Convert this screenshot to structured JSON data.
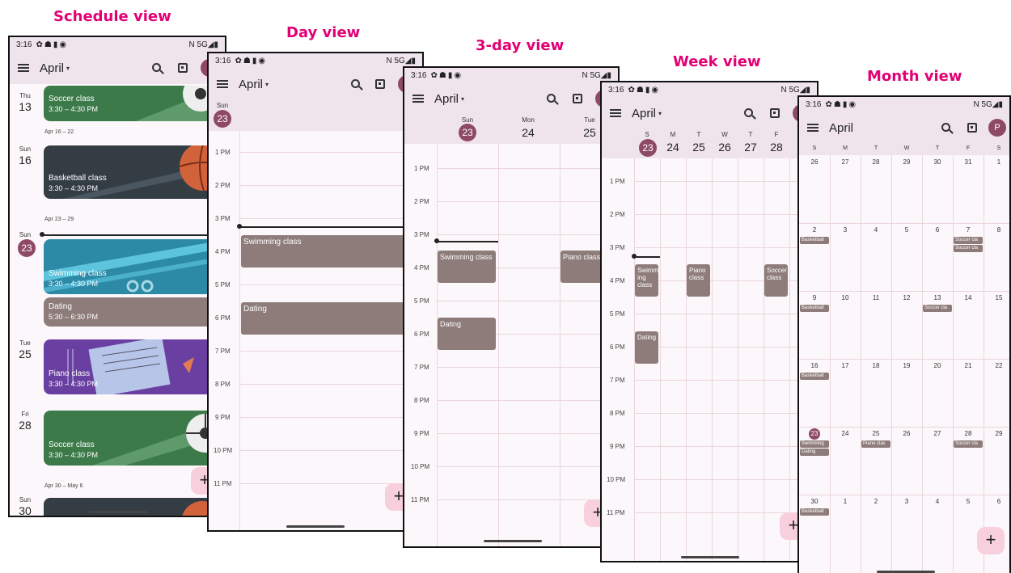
{
  "view_titles": {
    "schedule": "Schedule view",
    "day": "Day view",
    "three_day": "3-day view",
    "week": "Week view",
    "month": "Month view"
  },
  "status": {
    "time": "3:16",
    "network": "N 5G"
  },
  "header": {
    "month_label": "April",
    "caret": "▾",
    "avatar_initial": "P",
    "fab": "+"
  },
  "hours": [
    "1 PM",
    "2 PM",
    "3 PM",
    "4 PM",
    "5 PM",
    "6 PM",
    "7 PM",
    "8 PM",
    "9 PM",
    "10 PM",
    "11 PM"
  ],
  "schedule": {
    "ranges": [
      "Apr 16 – 22",
      "Apr 23 – 29",
      "Apr 30 – May 6"
    ],
    "days": [
      {
        "wd": "Thu",
        "d": "13"
      },
      {
        "wd": "Sun",
        "d": "16"
      },
      {
        "wd": "Sun",
        "d": "23"
      },
      {
        "wd": "Tue",
        "d": "25"
      },
      {
        "wd": "Fri",
        "d": "28"
      },
      {
        "wd": "Sun",
        "d": "30"
      }
    ],
    "events": [
      {
        "title": "Soccer class",
        "time": "3:30 – 4:30 PM"
      },
      {
        "title": "Basketball class",
        "time": "3:30 – 4:30 PM"
      },
      {
        "title": "Swimming class",
        "time": "3:30 – 4:30 PM"
      },
      {
        "title": "Dating",
        "time": "5:30 – 6:30 PM"
      },
      {
        "title": "Piano class",
        "time": "3:30 – 4:30 PM"
      },
      {
        "title": "Soccer class",
        "time": "3:30 – 4:30 PM"
      }
    ]
  },
  "day_view": {
    "wd": "Sun",
    "d": "23",
    "events": [
      "Swimming class",
      "Dating"
    ]
  },
  "three_day": {
    "days": [
      {
        "wd": "Sun",
        "d": "23"
      },
      {
        "wd": "Mon",
        "d": "24"
      },
      {
        "wd": "Tue",
        "d": "25"
      }
    ],
    "events": [
      "Swimming class",
      "Dating",
      "Piano class"
    ]
  },
  "week": {
    "letters": [
      "S",
      "M",
      "T",
      "W",
      "T",
      "F"
    ],
    "nums": [
      "23",
      "24",
      "25",
      "26",
      "27",
      "28"
    ],
    "events": [
      "Swimm ing class",
      "Dating",
      "Piano class",
      "Soccer class"
    ]
  },
  "month": {
    "weekdays": [
      "S",
      "M",
      "T",
      "W",
      "T",
      "F",
      "S"
    ],
    "weeks": [
      [
        "26",
        "27",
        "28",
        "29",
        "30",
        "31",
        "1"
      ],
      [
        "2",
        "3",
        "4",
        "5",
        "6",
        "7",
        "8"
      ],
      [
        "9",
        "10",
        "11",
        "12",
        "13",
        "14",
        "15"
      ],
      [
        "16",
        "17",
        "18",
        "19",
        "20",
        "21",
        "22"
      ],
      [
        "23",
        "24",
        "25",
        "26",
        "27",
        "28",
        "29"
      ],
      [
        "30",
        "1",
        "2",
        "3",
        "4",
        "5",
        "6"
      ]
    ],
    "chips": [
      "Basketball",
      "Soccer cla",
      "Soccer cla",
      "Basketball",
      "Soccer cla",
      "Basketball",
      "Swimming",
      "Dating",
      "Piano clas",
      "Soccer cla",
      "Basketball"
    ]
  }
}
